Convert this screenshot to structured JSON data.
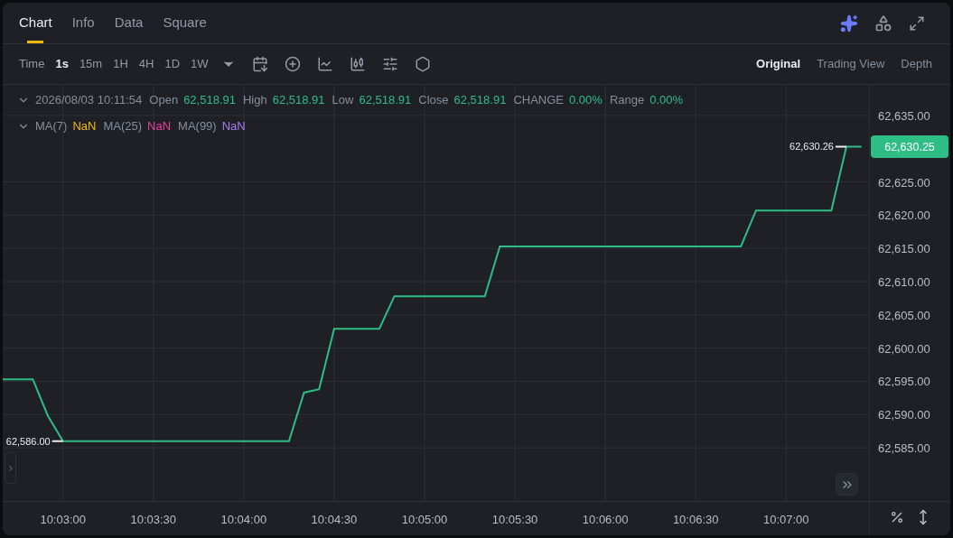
{
  "tabs": [
    {
      "label": "Chart",
      "selected": true
    },
    {
      "label": "Info",
      "selected": false
    },
    {
      "label": "Data",
      "selected": false
    },
    {
      "label": "Square",
      "selected": false
    }
  ],
  "toolbar": {
    "interval_label": "Time",
    "intervals": [
      {
        "label": "1s",
        "selected": true
      },
      {
        "label": "15m",
        "selected": false
      },
      {
        "label": "1H",
        "selected": false
      },
      {
        "label": "4H",
        "selected": false
      },
      {
        "label": "1D",
        "selected": false
      },
      {
        "label": "1W",
        "selected": false
      }
    ],
    "views": [
      {
        "label": "Original",
        "selected": true
      },
      {
        "label": "Trading View",
        "selected": false
      },
      {
        "label": "Depth",
        "selected": false
      }
    ]
  },
  "ohlc": {
    "date": "2026/08/03 10:11:54",
    "fields": [
      {
        "label": "Open",
        "value": "62,518.91"
      },
      {
        "label": "High",
        "value": "62,518.91"
      },
      {
        "label": "Low",
        "value": "62,518.91"
      },
      {
        "label": "Close",
        "value": "62,518.91"
      },
      {
        "label": "CHANGE",
        "value": "0.00%"
      },
      {
        "label": "Range",
        "value": "0.00%"
      }
    ]
  },
  "moving_averages": [
    {
      "label": "MA(7)",
      "value": "NaN",
      "color": "#f0b90b"
    },
    {
      "label": "MA(25)",
      "value": "NaN",
      "color": "#e6409a"
    },
    {
      "label": "MA(99)",
      "value": "NaN",
      "color": "#a47cf3"
    }
  ],
  "chart_data": {
    "type": "line",
    "grid": true,
    "ylim": [
      62577.0,
      62639.6
    ],
    "categories": [
      null,
      null,
      null,
      null,
      "10:03:00",
      null,
      null,
      null,
      null,
      null,
      "10:03:30",
      null,
      null,
      null,
      null,
      null,
      "10:04:00",
      null,
      null,
      null,
      null,
      null,
      "10:04:30",
      null,
      null,
      null,
      null,
      null,
      "10:05:00",
      null,
      null,
      null,
      null,
      null,
      "10:05:30",
      null,
      null,
      null,
      null,
      null,
      "10:06:00",
      null,
      null,
      null,
      null,
      null,
      "10:06:30",
      null,
      null,
      null,
      null,
      null,
      "10:07:00",
      null,
      null,
      null,
      null,
      null
    ],
    "yticks": [
      {
        "value": 62635,
        "label": "62,635.00"
      },
      {
        "value": 62625,
        "label": "62,625.00"
      },
      {
        "value": 62620,
        "label": "62,620.00"
      },
      {
        "value": 62615,
        "label": "62,615.00"
      },
      {
        "value": 62610,
        "label": "62,610.00"
      },
      {
        "value": 62605,
        "label": "62,605.00"
      },
      {
        "value": 62600,
        "label": "62,600.00"
      },
      {
        "value": 62595,
        "label": "62,595.00"
      },
      {
        "value": 62590,
        "label": "62,590.00"
      },
      {
        "value": 62585,
        "label": "62,585.00"
      }
    ],
    "series": [
      {
        "color": "#2ebd85",
        "values": [
          62595.3,
          62595.3,
          62595.3,
          62589.8,
          62586.0,
          62586.0,
          62586.0,
          62586.0,
          62586.0,
          62586.0,
          62586.0,
          62586.0,
          62586.0,
          62586.0,
          62586.0,
          62586.0,
          62586.0,
          62586.0,
          62586.0,
          62586.0,
          62593.3,
          62593.8,
          62602.9,
          62602.9,
          62602.9,
          62602.9,
          62607.8,
          62607.8,
          62607.8,
          62607.8,
          62607.8,
          62607.8,
          62607.8,
          62615.3,
          62615.3,
          62615.3,
          62615.3,
          62615.3,
          62615.3,
          62615.3,
          62615.3,
          62615.3,
          62615.3,
          62615.3,
          62615.3,
          62615.3,
          62615.3,
          62615.3,
          62615.3,
          62615.3,
          62620.7,
          62620.7,
          62620.7,
          62620.7,
          62620.7,
          62620.7,
          62630.3,
          62630.3
        ]
      }
    ],
    "annotations": [
      "62,586.00",
      "62,630.26"
    ]
  },
  "last_price": "62,630.25"
}
